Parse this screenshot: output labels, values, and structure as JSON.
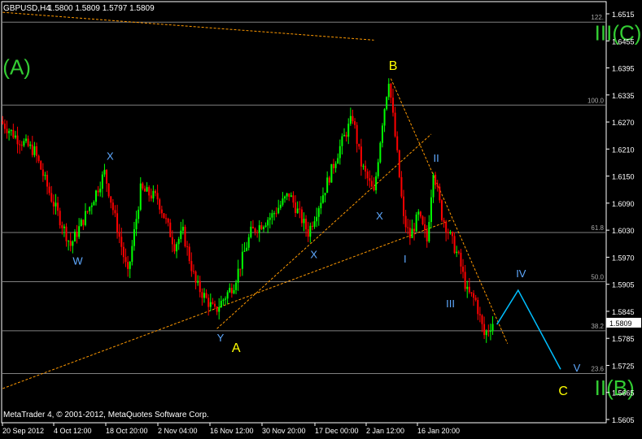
{
  "header": {
    "symbol": "GBPUSD,H4",
    "quote": "1.5800 1.5809 1.5797 1.5809"
  },
  "footer": {
    "copyright": "MetaTrader 4, © 2001-2012, MetaQuotes Software Corp."
  },
  "colors": {
    "background": "#000000",
    "grid": "#808080",
    "bull_candle": "#00ff00",
    "bear_candle": "#ff0000",
    "trendline": "#ff9900",
    "projection": "#00bfff",
    "wave_green": "#33cc33",
    "wave_yellow": "#ffff00",
    "wave_blue": "#5fa9ff"
  },
  "chart_data": {
    "type": "candlestick",
    "symbol": "GBPUSD",
    "timeframe": "H4",
    "ylim": [
      1.5575,
      1.656
    ],
    "y_ticks": [
      "1.6515",
      "1.6455",
      "1.6395",
      "1.6335",
      "1.6270",
      "1.6210",
      "1.6150",
      "1.6090",
      "1.6030",
      "1.5970",
      "1.5905",
      "1.5845",
      "1.5785",
      "1.5725",
      "1.5665",
      "1.5605"
    ],
    "x_ticks": [
      "20 Sep 2012",
      "4 Oct 12:00",
      "18 Oct 20:00",
      "2 Nov 04:00",
      "16 Nov 12:00",
      "30 Nov 20:00",
      "17 Dec 00:00",
      "2 Jan 12:00",
      "16 Jan 20:00"
    ],
    "current_price": "1.5809",
    "fib_levels": [
      {
        "label": "122.",
        "price": 1.6512
      },
      {
        "label": "100.0",
        "price": 1.6318
      },
      {
        "label": "61.8",
        "price": 1.602
      },
      {
        "label": "50.0",
        "price": 1.5905
      },
      {
        "label": "38.2",
        "price": 1.579
      },
      {
        "label": "23.6",
        "price": 1.569
      }
    ],
    "wave_labels": [
      {
        "text": "(A)",
        "bar": 0,
        "price": 1.639,
        "color": "green"
      },
      {
        "text": "III(C)",
        "bar": 279,
        "price": 1.647,
        "color": "green"
      },
      {
        "text": "II(B)",
        "bar": 279,
        "price": 1.564,
        "color": "green"
      },
      {
        "text": "B",
        "bar": 182,
        "price": 1.64,
        "color": "yellow"
      },
      {
        "text": "A",
        "bar": 108,
        "price": 1.574,
        "color": "yellow"
      },
      {
        "text": "C",
        "bar": 262,
        "price": 1.564,
        "color": "yellow"
      },
      {
        "text": "W",
        "bar": 33,
        "price": 1.5945,
        "color": "blue"
      },
      {
        "text": "X",
        "bar": 49,
        "price": 1.619,
        "color": "blue"
      },
      {
        "text": "Y",
        "bar": 101,
        "price": 1.5765,
        "color": "blue"
      },
      {
        "text": "X",
        "bar": 145,
        "price": 1.596,
        "color": "blue"
      },
      {
        "text": "X",
        "bar": 176,
        "price": 1.605,
        "color": "blue"
      },
      {
        "text": "I",
        "bar": 189,
        "price": 1.595,
        "color": "blue"
      },
      {
        "text": "II",
        "bar": 203,
        "price": 1.6185,
        "color": "blue"
      },
      {
        "text": "III",
        "bar": 209,
        "price": 1.5845,
        "color": "blue"
      },
      {
        "text": "IV",
        "bar": 242,
        "price": 1.5915,
        "color": "blue"
      },
      {
        "text": "V",
        "bar": 269,
        "price": 1.5695,
        "color": "blue"
      }
    ],
    "projection_path": [
      {
        "bar": 233,
        "price": 1.5805
      },
      {
        "bar": 243,
        "price": 1.5885
      },
      {
        "bar": 263,
        "price": 1.57
      }
    ],
    "trendlines": [
      {
        "from": {
          "bar": 0,
          "price": 1.6535
        },
        "to": {
          "bar": 175,
          "price": 1.647
        }
      },
      {
        "from": {
          "bar": 0,
          "price": 1.5655
        },
        "to": {
          "bar": 212,
          "price": 1.605
        }
      },
      {
        "from": {
          "bar": 101,
          "price": 1.5795
        },
        "to": {
          "bar": 202,
          "price": 1.625
        }
      },
      {
        "from": {
          "bar": 183,
          "price": 1.638
        },
        "to": {
          "bar": 238,
          "price": 1.576
        }
      }
    ],
    "pivots": [
      {
        "bar": 0,
        "price": 1.628
      },
      {
        "bar": 8,
        "price": 1.624
      },
      {
        "bar": 16,
        "price": 1.621
      },
      {
        "bar": 24,
        "price": 1.61
      },
      {
        "bar": 33,
        "price": 1.599
      },
      {
        "bar": 42,
        "price": 1.608
      },
      {
        "bar": 49,
        "price": 1.616
      },
      {
        "bar": 56,
        "price": 1.601
      },
      {
        "bar": 60,
        "price": 1.592
      },
      {
        "bar": 66,
        "price": 1.612
      },
      {
        "bar": 74,
        "price": 1.61
      },
      {
        "bar": 82,
        "price": 1.599
      },
      {
        "bar": 86,
        "price": 1.602
      },
      {
        "bar": 92,
        "price": 1.59
      },
      {
        "bar": 101,
        "price": 1.5835
      },
      {
        "bar": 110,
        "price": 1.59
      },
      {
        "bar": 118,
        "price": 1.602
      },
      {
        "bar": 128,
        "price": 1.606
      },
      {
        "bar": 136,
        "price": 1.611
      },
      {
        "bar": 145,
        "price": 1.602
      },
      {
        "bar": 152,
        "price": 1.611
      },
      {
        "bar": 160,
        "price": 1.622
      },
      {
        "bar": 166,
        "price": 1.629
      },
      {
        "bar": 170,
        "price": 1.618
      },
      {
        "bar": 176,
        "price": 1.611
      },
      {
        "bar": 180,
        "price": 1.628
      },
      {
        "bar": 183,
        "price": 1.638
      },
      {
        "bar": 187,
        "price": 1.62
      },
      {
        "bar": 190,
        "price": 1.605
      },
      {
        "bar": 193,
        "price": 1.601
      },
      {
        "bar": 197,
        "price": 1.606
      },
      {
        "bar": 201,
        "price": 1.6
      },
      {
        "bar": 204,
        "price": 1.617
      },
      {
        "bar": 208,
        "price": 1.606
      },
      {
        "bar": 212,
        "price": 1.601
      },
      {
        "bar": 216,
        "price": 1.596
      },
      {
        "bar": 220,
        "price": 1.588
      },
      {
        "bar": 224,
        "price": 1.586
      },
      {
        "bar": 228,
        "price": 1.578
      },
      {
        "bar": 232,
        "price": 1.5809
      }
    ]
  }
}
